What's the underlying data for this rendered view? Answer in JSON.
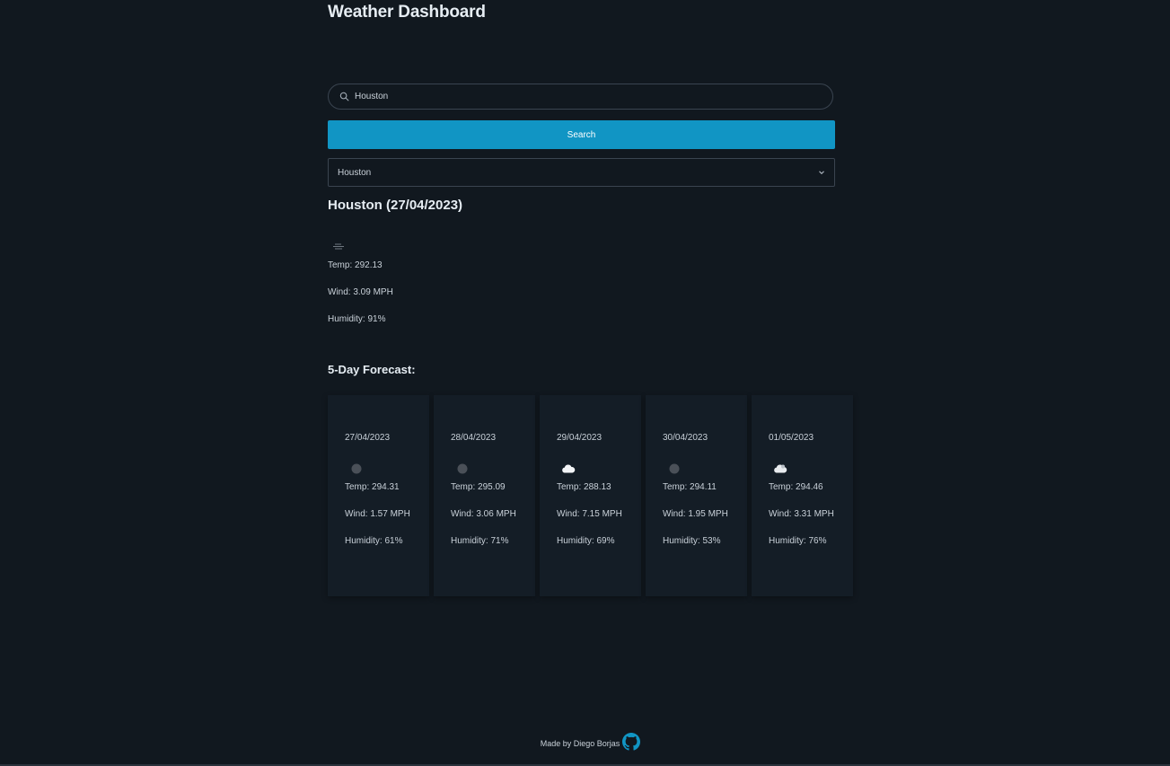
{
  "app": {
    "title": "Weather Dashboard"
  },
  "search": {
    "value": "Houston",
    "button_label": "Search"
  },
  "city_select": {
    "selected": "Houston"
  },
  "current": {
    "heading": "Houston (27/04/2023)",
    "icon": "mist-icon",
    "temp": "Temp: 292.13",
    "wind": "Wind: 3.09 MPH",
    "humidity": "Humidity: 91%"
  },
  "forecast": {
    "heading": "5-Day Forecast:",
    "days": [
      {
        "date": "27/04/2023",
        "icon": "overcast-icon",
        "temp": "Temp: 294.31",
        "wind": "Wind: 1.57 MPH",
        "humidity": "Humidity: 61%"
      },
      {
        "date": "28/04/2023",
        "icon": "overcast-icon",
        "temp": "Temp: 295.09",
        "wind": "Wind: 3.06 MPH",
        "humidity": "Humidity: 71%"
      },
      {
        "date": "29/04/2023",
        "icon": "cloud-icon",
        "temp": "Temp: 288.13",
        "wind": "Wind: 7.15 MPH",
        "humidity": "Humidity: 69%"
      },
      {
        "date": "30/04/2023",
        "icon": "overcast-icon",
        "temp": "Temp: 294.11",
        "wind": "Wind: 1.95 MPH",
        "humidity": "Humidity: 53%"
      },
      {
        "date": "01/05/2023",
        "icon": "cloud-icon",
        "temp": "Temp: 294.46",
        "wind": "Wind: 3.31 MPH",
        "humidity": "Humidity: 76%"
      }
    ]
  },
  "footer": {
    "text": "Made by Diego Borjas",
    "icon": "github-icon"
  },
  "colors": {
    "background": "#11181f",
    "accent": "#1195c4",
    "card": "#141d26",
    "github": "#1195c4"
  }
}
